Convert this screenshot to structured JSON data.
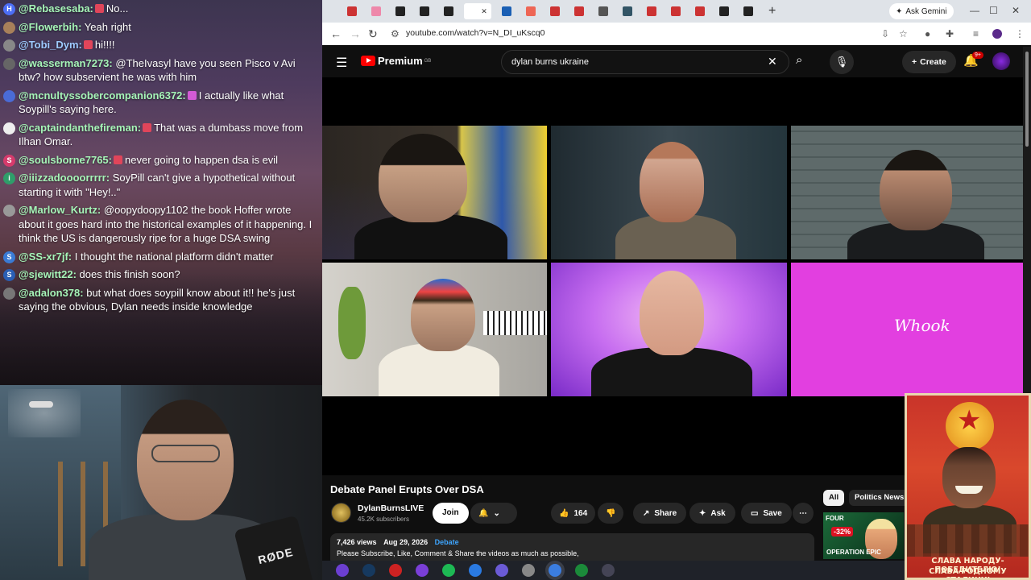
{
  "chat": {
    "messages": [
      {
        "user": "@Rebasesaba:",
        "text": "No...",
        "avatar": "H",
        "avatar_color": "#4c6ef5",
        "badge": "red"
      },
      {
        "user": "@Flowerbih:",
        "text": "Yeah right",
        "avatar": "",
        "avatar_color": "#a8805a",
        "badge": ""
      },
      {
        "user": "@Tobi_Dym:",
        "text": "hi!!!!",
        "avatar": "",
        "avatar_color": "#888",
        "badge": "red",
        "user_color": "blue"
      },
      {
        "user": "@wasserman7273:",
        "text": "@TheIvasyl have you seen Pisco v Avi btw? how subservient he was with him",
        "avatar": "",
        "avatar_color": "#666",
        "badge": ""
      },
      {
        "user": "@mcnultyssobercompanion6372:",
        "text": "I actually like what Soypill's saying here.",
        "avatar": "",
        "avatar_color": "#4a6bd6",
        "badge": "pink"
      },
      {
        "user": "@captaindanthefireman:",
        "text": "That was a dumbass move from Ilhan Omar.",
        "avatar": "",
        "avatar_color": "#eee",
        "badge": "red"
      },
      {
        "user": "@soulsborne7765:",
        "text": "never going to happen dsa is evil",
        "avatar": "S",
        "avatar_color": "#d63b6c",
        "badge": "red"
      },
      {
        "user": "@iiizzadoooorrrrr:",
        "text": "SoyPill can't give a hypothetical without starting it with \"Hey!..\"",
        "avatar": "i",
        "avatar_color": "#2f9e6a",
        "badge": ""
      },
      {
        "user": "@Marlow_Kurtz:",
        "text": "@oopydoopy1102 the book Hoffer wrote about it goes hard into the historical examples of it happening. I think the US is dangerously ripe for a huge DSA swing",
        "avatar": "",
        "avatar_color": "#999",
        "badge": ""
      },
      {
        "user": "@SS-xr7jf:",
        "text": "I thought the national platform didn't matter",
        "avatar": "S",
        "avatar_color": "#3a7bd5",
        "badge": ""
      },
      {
        "user": "@sjewitt22:",
        "text": "does this finish soon?",
        "avatar": "S",
        "avatar_color": "#2a5fb5",
        "badge": ""
      },
      {
        "user": "@adalon378:",
        "text": "but what does soypill know about it!! he's just saying the obvious, Dylan needs inside knowledge",
        "avatar": "",
        "avatar_color": "#777",
        "badge": ""
      }
    ]
  },
  "webcam": {
    "mic_brand": "RØDE"
  },
  "browser": {
    "tab_count": 20,
    "gemini_label": "Ask Gemini",
    "url": "youtube.com/watch?v=N_DI_uKscq0"
  },
  "youtube": {
    "logo_text": "Premium",
    "region": "GB",
    "search_query": "dylan burns ukraine",
    "create_label": "Create",
    "notif_count": "9+",
    "video_title": "Debate Panel Erupts Over DSA",
    "channel_name": "DylanBurnsLIVE",
    "subscribers": "45.2K subscribers",
    "join_label": "Join",
    "likes": "164",
    "share_label": "Share",
    "ask_label": "Ask",
    "save_label": "Save",
    "views": "7,426 views",
    "date": "Aug 29, 2026",
    "category_tag": "Debate",
    "description": "Please Subscribe, Like, Comment & Share the videos as much as possible,",
    "chips": [
      "All",
      "Politics News"
    ],
    "rec": {
      "line1": "FOUR",
      "pct": "-32%",
      "line2": "OPERATION EPIC"
    },
    "panel_watermark": "Whook"
  },
  "poster": {
    "slogan_line1": "СЛАВА НАРОДУ-ПОБЕДИТЕЛЮ!",
    "slogan_line2": "СЛАВА РОДНОМУ СТАЛИНУ!"
  },
  "colors": {
    "yt_red": "#ff0000",
    "chat_user": "#a6f5b8",
    "highlight": "#7fd08a",
    "panel_magenta": "#e23fe0"
  }
}
